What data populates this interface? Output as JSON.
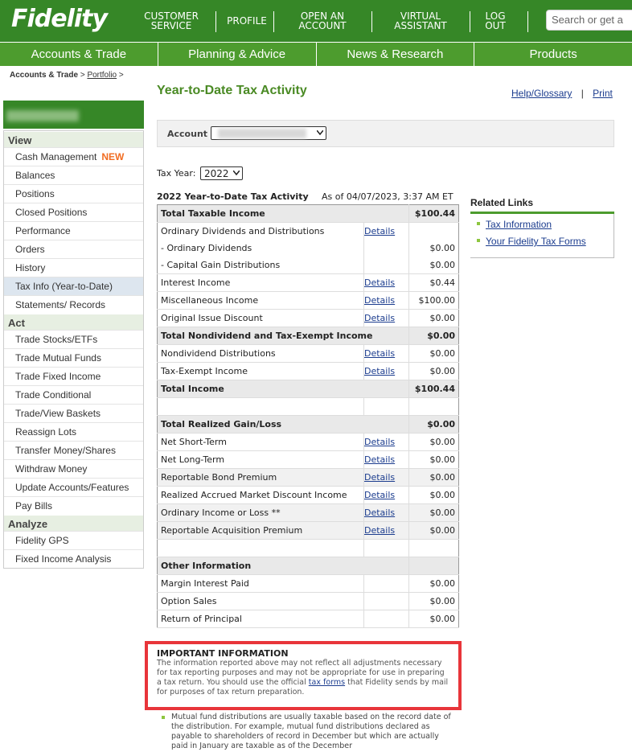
{
  "header": {
    "logo": "Fidelity",
    "links": [
      {
        "line1": "CUSTOMER",
        "line2": "SERVICE"
      },
      {
        "line1": "PROFILE",
        "line2": ""
      },
      {
        "line1": "OPEN AN",
        "line2": "ACCOUNT"
      },
      {
        "line1": "VIRTUAL",
        "line2": "ASSISTANT"
      },
      {
        "line1": "LOG",
        "line2": "OUT"
      }
    ],
    "search_placeholder": "Search or get a",
    "nav": [
      "Accounts & Trade",
      "Planning & Advice",
      "News & Research",
      "Products"
    ]
  },
  "breadcrumb": {
    "first": "Accounts & Trade",
    "sep": ">",
    "second": "Portfolio",
    "end": ">"
  },
  "sidebar": {
    "sections": [
      {
        "title": "View",
        "items": [
          "Cash Management",
          "Balances",
          "Positions",
          "Closed Positions",
          "Performance",
          "Orders",
          "History",
          "Tax Info (Year-to-Date)",
          "Statements/ Records"
        ]
      },
      {
        "title": "Act",
        "items": [
          "Trade Stocks/ETFs",
          "Trade Mutual Funds",
          "Trade Fixed Income",
          "Trade Conditional",
          "Trade/View Baskets",
          "Reassign Lots",
          "Transfer Money/Shares",
          "Withdraw Money",
          "Update Accounts/Features",
          "Pay Bills"
        ]
      },
      {
        "title": "Analyze",
        "items": [
          "Fidelity GPS",
          "Fixed Income Analysis"
        ]
      }
    ],
    "new_badge": "NEW",
    "active_item": "Tax Info (Year-to-Date)"
  },
  "page": {
    "title": "Year-to-Date Tax Activity",
    "help_label": "Help/Glossary",
    "print_label": "Print",
    "sep": "|",
    "account_label": "Account",
    "tax_year_label": "Tax Year:",
    "tax_year_value": "2022",
    "table_title": "2022 Year-to-Date Tax Activity",
    "as_of": "As of 04/07/2023, 3:37 AM ET",
    "details_label": "Details"
  },
  "rows": [
    {
      "label": "Total Taxable Income",
      "details": false,
      "value": "$100.44",
      "type": "tot"
    },
    {
      "label": "Ordinary Dividends and Distributions",
      "details": true,
      "value": "",
      "type": "sub"
    },
    {
      "label": "- Ordinary Dividends",
      "details": false,
      "value": "$0.00",
      "type": "sub"
    },
    {
      "label": "- Capital Gain Distributions",
      "details": false,
      "value": "$0.00",
      "type": "row"
    },
    {
      "label": "Interest Income",
      "details": true,
      "value": "$0.44",
      "type": "row"
    },
    {
      "label": "Miscellaneous Income",
      "details": true,
      "value": "$100.00",
      "type": "row"
    },
    {
      "label": "Original Issue Discount",
      "details": true,
      "value": "$0.00",
      "type": "row"
    },
    {
      "label": "Total Nondividend and Tax-Exempt Income",
      "details": false,
      "value": "$0.00",
      "type": "tot"
    },
    {
      "label": "Nondividend Distributions",
      "details": true,
      "value": "$0.00",
      "type": "row"
    },
    {
      "label": "Tax-Exempt Income",
      "details": true,
      "value": "$0.00",
      "type": "row"
    },
    {
      "label": "Total Income",
      "details": false,
      "value": "$100.44",
      "type": "tot"
    },
    {
      "label": "",
      "details": false,
      "value": "",
      "type": "blank"
    },
    {
      "label": "Total Realized Gain/Loss",
      "details": false,
      "value": "$0.00",
      "type": "tot"
    },
    {
      "label": "Net Short-Term",
      "details": true,
      "value": "$0.00",
      "type": "row"
    },
    {
      "label": "Net Long-Term",
      "details": true,
      "value": "$0.00",
      "type": "row"
    },
    {
      "label": "Reportable Bond Premium",
      "details": true,
      "value": "$0.00",
      "type": "shade"
    },
    {
      "label": "Realized Accrued Market Discount Income",
      "details": true,
      "value": "$0.00",
      "type": "row"
    },
    {
      "label": "Ordinary Income or Loss **",
      "details": true,
      "value": "$0.00",
      "type": "shade"
    },
    {
      "label": "Reportable Acquisition Premium",
      "details": true,
      "value": "$0.00",
      "type": "shade"
    },
    {
      "label": "",
      "details": false,
      "value": "",
      "type": "blank"
    },
    {
      "label": "Other Information",
      "details": false,
      "value": "",
      "type": "tot"
    },
    {
      "label": "Margin Interest Paid",
      "details": false,
      "value": "$0.00",
      "type": "row"
    },
    {
      "label": "Option Sales",
      "details": false,
      "value": "$0.00",
      "type": "row"
    },
    {
      "label": "Return of Principal",
      "details": false,
      "value": "$0.00",
      "type": "row"
    }
  ],
  "related": {
    "title": "Related Links",
    "links": [
      "Tax Information",
      "Your Fidelity Tax Forms"
    ]
  },
  "important": {
    "title": "IMPORTANT INFORMATION",
    "text_before": "The information reported above may not reflect all adjustments necessary for tax reporting purposes and may not be appropriate for use in preparing a tax return. You should use the official ",
    "link": "tax forms",
    "text_after": " that Fidelity sends by mail for purposes of tax return preparation."
  },
  "note": "Mutual fund distributions are usually taxable based on the record date of the distribution. For example, mutual fund distributions declared as payable to shareholders of record in December but which are actually paid in January are taxable as of the December",
  "colors": {
    "brand_green": "#368727",
    "nav_green": "#4d9c2e",
    "new_orange": "#f16d22",
    "link_blue": "#1b3c8e",
    "alert_red": "#e8353a"
  }
}
